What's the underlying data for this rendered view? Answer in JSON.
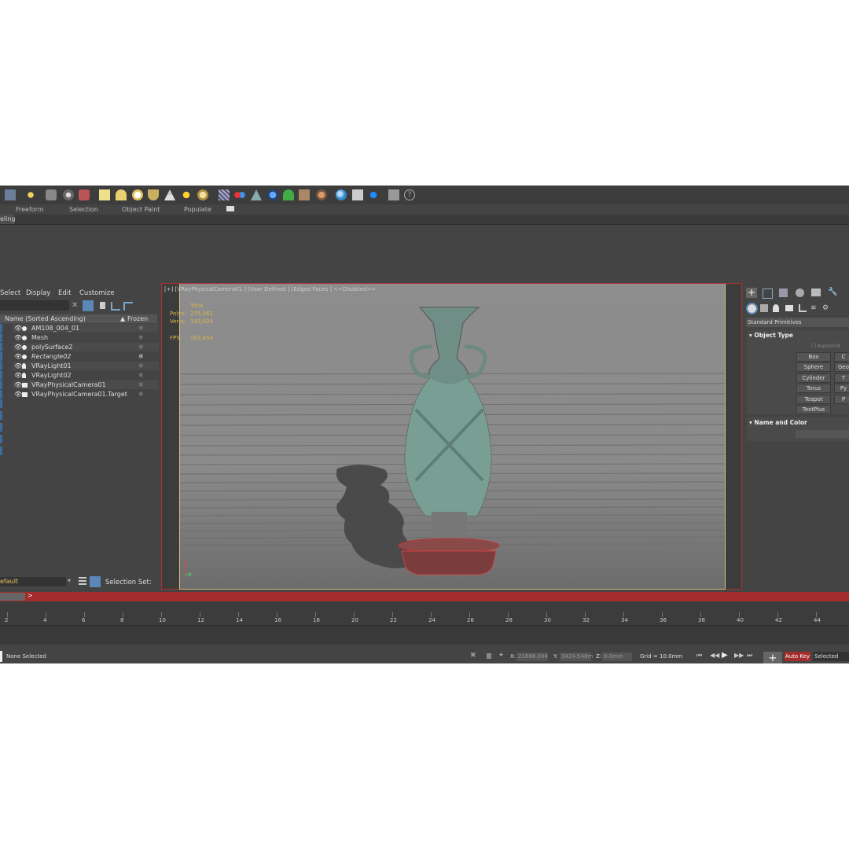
{
  "ribbon": {
    "tabs": [
      "Freeform",
      "Selection",
      "Object Paint",
      "Populate"
    ],
    "modeling_tab": "eling"
  },
  "explorer": {
    "menu": [
      "Select",
      "Display",
      "Edit",
      "Customize"
    ],
    "columns": {
      "name": "Name (Sorted Ascending)",
      "frozen": "Frozen"
    },
    "rows": [
      "AM108_004_01",
      "Mesh",
      "polySurface2",
      "Rectangle02",
      "VRayLight01",
      "VRayLight02",
      "VRayPhysicalCamera01",
      "VRayPhysicalCamera01.Target"
    ],
    "layer": "efault",
    "selection_set_label": "Selection Set:"
  },
  "viewport": {
    "label": "[+] [VRayPhysicalCamera01 ] [User Defined ] [Edged Faces ]  <<Disabled>>",
    "stats": {
      "total": "Total",
      "polys_label": "Polys:",
      "polys": "275,162",
      "verts_label": "Verts:",
      "verts": "143,024",
      "fps_label": "FPS:",
      "fps": "203.454"
    },
    "axis_y": "Y"
  },
  "command_panel": {
    "dropdown": "Standard Primitives",
    "object_type_title": "Object Type",
    "autogrid": "AutoGrid",
    "buttons": [
      "Box",
      "Sphere",
      "Cylinder",
      "Torus",
      "Teapot",
      "TextPlus"
    ],
    "buttons_right": [
      "C",
      "Geo",
      "T",
      "Py",
      "P"
    ],
    "name_color_title": "Name and Color"
  },
  "timeline": {
    "ticks": [
      "2",
      "4",
      "6",
      "8",
      "10",
      "12",
      "14",
      "16",
      "18",
      "20",
      "22",
      "24",
      "26",
      "28",
      "30",
      "32",
      "34",
      "36",
      "38",
      "40",
      "42",
      "44"
    ]
  },
  "status": {
    "message": "None Selected",
    "x_label": "X:",
    "x": "21686.004",
    "y_label": "Y:",
    "y": "3424.548m",
    "z_label": "Z:",
    "z": "0.0mm",
    "grid": "Grid = 10.0mm",
    "autokey": "Auto Key",
    "selected": "Selected"
  },
  "colors": {
    "accent_red": "#a42c2c",
    "selection_blue": "#3d6b9e",
    "stats_yellow": "#d8b84a"
  }
}
